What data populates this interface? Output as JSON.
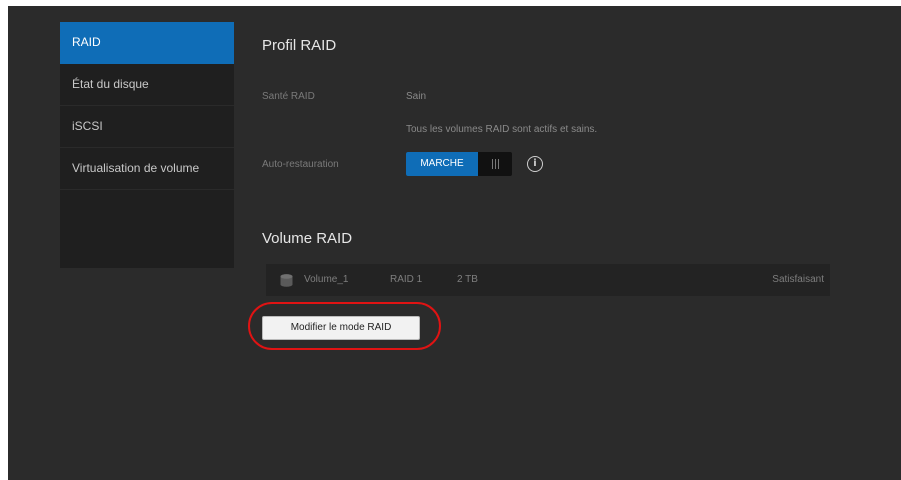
{
  "sidebar": {
    "items": [
      {
        "label": "RAID",
        "active": true
      },
      {
        "label": "État du disque",
        "active": false
      },
      {
        "label": "iSCSI",
        "active": false
      },
      {
        "label": "Virtualisation de volume",
        "active": false
      }
    ]
  },
  "raid_profile": {
    "title": "Profil RAID",
    "health_label": "Santé RAID",
    "health_value": "Sain",
    "health_detail": "Tous les volumes RAID sont actifs et sains.",
    "auto_restore_label": "Auto-restauration",
    "auto_restore_toggle": "MARCHE"
  },
  "raid_volume": {
    "title": "Volume RAID",
    "volumes": [
      {
        "name": "Volume_1",
        "raid": "RAID 1",
        "size": "2 TB",
        "status": "Satisfaisant"
      }
    ],
    "modify_button": "Modifier le mode RAID"
  },
  "colors": {
    "accent": "#0f6db7",
    "background": "#2b2b2b",
    "highlight": "#e01313"
  }
}
